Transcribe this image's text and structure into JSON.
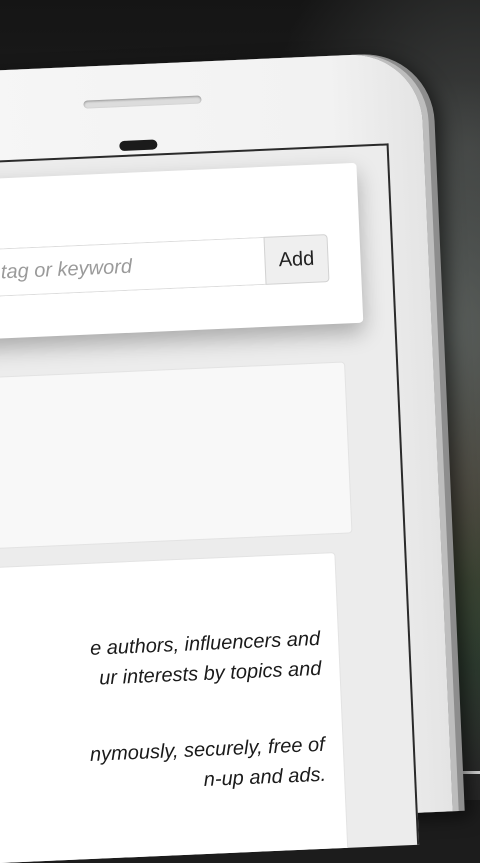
{
  "hashtag_form": {
    "input_placeholder": "ntag or keyword",
    "add_label": "Add"
  },
  "info_card": {
    "paragraph_1": [
      "e authors, influencers and",
      "ur interests by topics and"
    ],
    "paragraph_2": [
      "nymously, securely, free of",
      "n-up and ads."
    ]
  }
}
